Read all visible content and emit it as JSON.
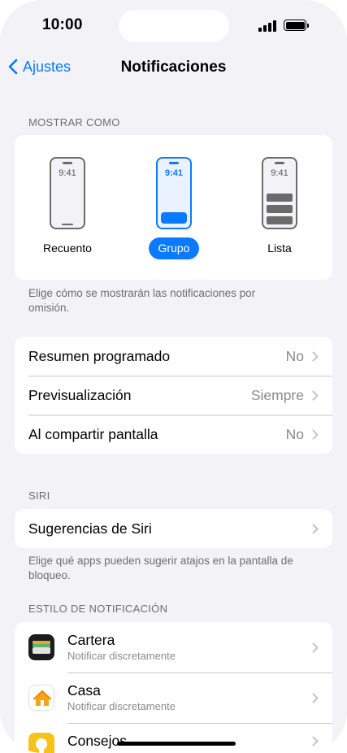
{
  "status_bar": {
    "time": "10:00"
  },
  "nav": {
    "back_label": "Ajustes",
    "title": "Notificaciones"
  },
  "display_style": {
    "header": "MOSTRAR COMO",
    "options": [
      {
        "label": "Recuento",
        "clock": "9:41",
        "selected": false
      },
      {
        "label": "Grupo",
        "clock": "9:41",
        "selected": true
      },
      {
        "label": "Lista",
        "clock": "9:41",
        "selected": false
      }
    ],
    "footnote": "Elige cómo se mostrarán las notificaciones por omisión."
  },
  "general": {
    "rows": [
      {
        "label": "Resumen programado",
        "value": "No"
      },
      {
        "label": "Previsualización",
        "value": "Siempre"
      },
      {
        "label": "Al compartir pantalla",
        "value": "No"
      }
    ]
  },
  "siri": {
    "header": "SIRI",
    "row_label": "Sugerencias de Siri",
    "footnote": "Elige qué apps pueden sugerir atajos en la pantalla de bloqueo."
  },
  "notification_style": {
    "header": "ESTILO DE NOTIFICACIÓN",
    "apps": [
      {
        "name": "Cartera",
        "subtitle": "Notificar discretamente",
        "icon": "wallet-icon"
      },
      {
        "name": "Casa",
        "subtitle": "Notificar discretamente",
        "icon": "home-icon"
      },
      {
        "name": "Consejos",
        "subtitle": "",
        "icon": "tips-icon"
      }
    ]
  },
  "colors": {
    "accent": "#0a7aff",
    "background": "#f2f2f7"
  }
}
